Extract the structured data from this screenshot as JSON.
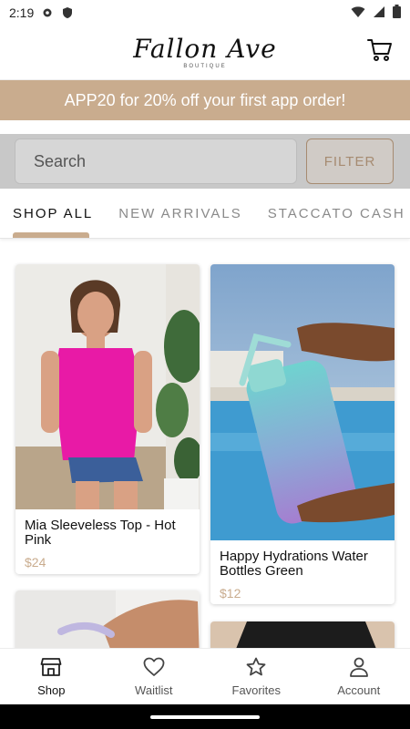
{
  "status_bar": {
    "time": "2:19"
  },
  "header": {
    "brand": "Fallon Ave",
    "brand_sub": "BOUTIQUE"
  },
  "promo": {
    "text": "APP20 for 20% off your first app order!"
  },
  "search": {
    "placeholder": "Search",
    "filter_label": "FILTER"
  },
  "tabs": [
    {
      "label": "SHOP ALL",
      "active": true
    },
    {
      "label": "NEW ARRIVALS",
      "active": false
    },
    {
      "label": "STACCATO CASH BA",
      "active": false
    }
  ],
  "products": [
    {
      "name": "Mia Sleeveless Top - Hot Pink",
      "price": "$24"
    },
    {
      "name": "Happy Hydrations Water Bottles Green",
      "price": "$12"
    }
  ],
  "bottom_nav": [
    {
      "label": "Shop",
      "icon": "store-icon",
      "active": true
    },
    {
      "label": "Waitlist",
      "icon": "heart-icon",
      "active": false
    },
    {
      "label": "Favorites",
      "icon": "star-icon",
      "active": false
    },
    {
      "label": "Account",
      "icon": "person-icon",
      "active": false
    }
  ],
  "colors": {
    "accent": "#c9ac8e",
    "filter_text": "#a68b71",
    "search_bg": "#c8c8c8"
  }
}
